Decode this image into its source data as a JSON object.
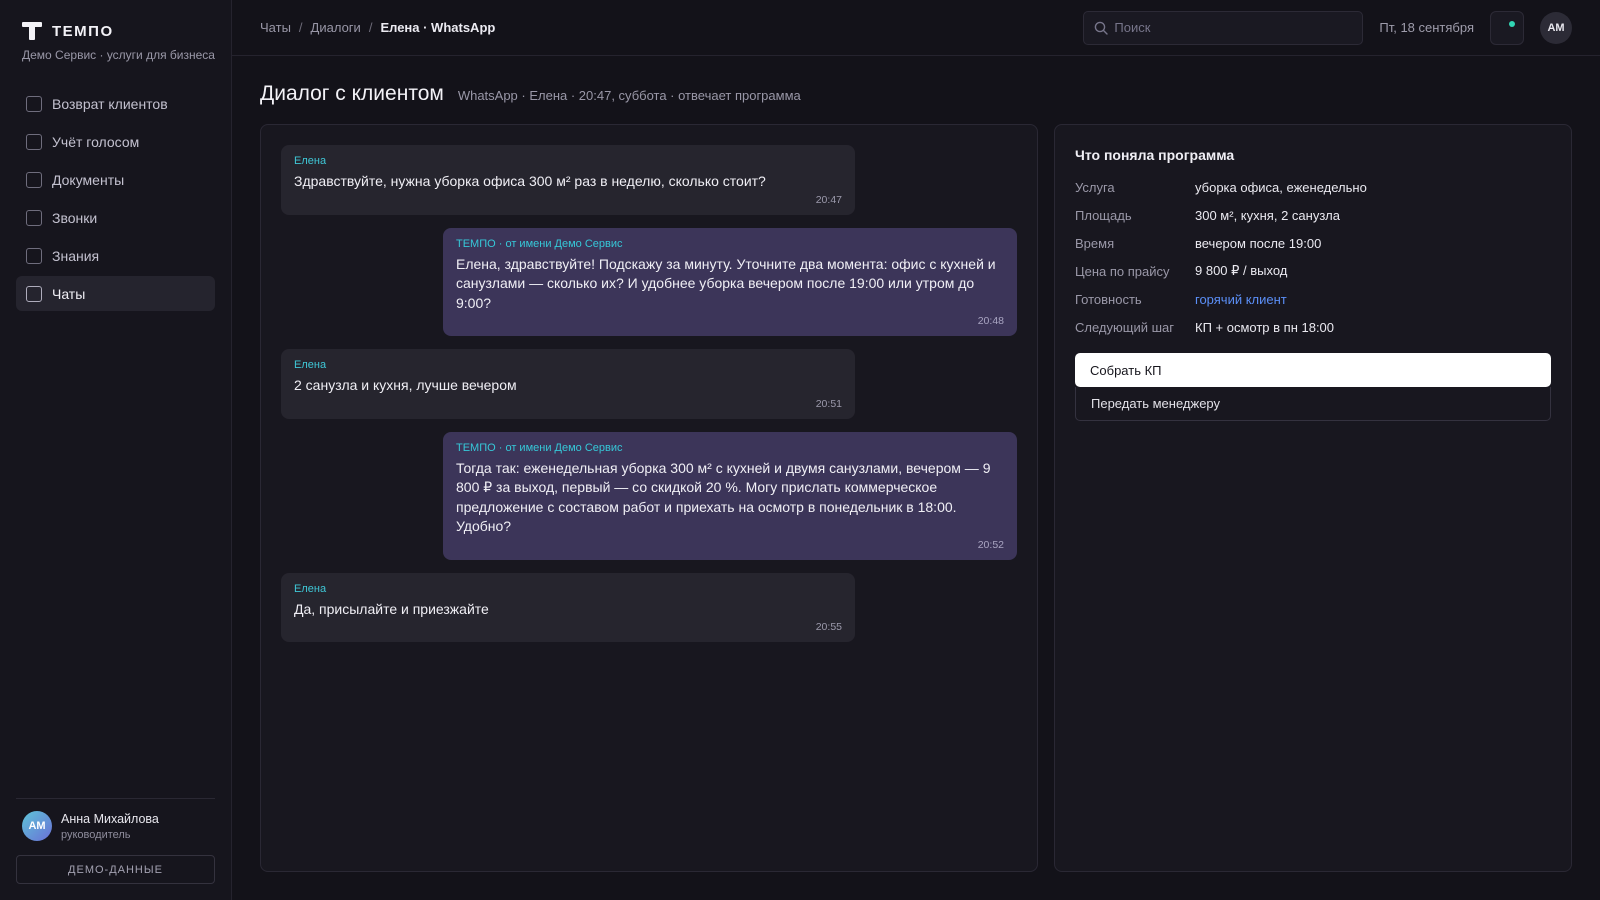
{
  "brand": {
    "name": "ТЕМПО",
    "subtitle": "Демо Сервис · услуги для бизнеса"
  },
  "sidebar": {
    "items": [
      {
        "label": "Возврат клиентов"
      },
      {
        "label": "Учёт голосом"
      },
      {
        "label": "Документы"
      },
      {
        "label": "Звонки"
      },
      {
        "label": "Знания"
      },
      {
        "label": "Чаты",
        "active": true
      }
    ],
    "user": {
      "initials": "АМ",
      "name": "Анна Михайлова",
      "role": "руководитель"
    },
    "demo_button": "ДЕМО-ДАННЫЕ"
  },
  "header": {
    "breadcrumbs": [
      "Чаты",
      "Диалоги",
      "Елена · WhatsApp"
    ],
    "search_placeholder": "Поиск",
    "date": "Пт, 18 сентября",
    "avatar_initials": "АМ"
  },
  "page": {
    "title": "Диалог с клиентом",
    "meta": "WhatsApp · Елена · 20:47, суббота · отвечает программа"
  },
  "messages": [
    {
      "direction": "in",
      "author": "Елена",
      "text": "Здравствуйте, нужна уборка офиса 300 м² раз в неделю, сколько стоит?",
      "time": "20:47"
    },
    {
      "direction": "out",
      "author": "ТЕМПО · от имени Демо Сервис",
      "text": "Елена, здравствуйте! Подскажу за минуту. Уточните два момента: офис с кухней и санузлами — сколько их? И удобнее уборка вечером после 19:00 или утром до 9:00?",
      "time": "20:48"
    },
    {
      "direction": "in",
      "author": "Елена",
      "text": "2 санузла и кухня, лучше вечером",
      "time": "20:51"
    },
    {
      "direction": "out",
      "author": "ТЕМПО · от имени Демо Сервис",
      "text": "Тогда так: еженедельная уборка 300 м² с кухней и двумя санузлами, вечером — 9 800 ₽ за выход, первый — со скидкой 20 %. Могу прислать коммерческое предложение с составом работ и приехать на осмотр в понедельник в 18:00. Удобно?",
      "time": "20:52"
    },
    {
      "direction": "in",
      "author": "Елена",
      "text": "Да, присылайте и приезжайте",
      "time": "20:55"
    }
  ],
  "insights": {
    "title": "Что поняла программа",
    "rows": [
      {
        "key": "Услуга",
        "value": "уборка офиса, еженедельно"
      },
      {
        "key": "Площадь",
        "value": "300 м², кухня, 2 санузла"
      },
      {
        "key": "Время",
        "value": "вечером после 19:00"
      },
      {
        "key": "Цена по прайсу",
        "value": "9 800 ₽ / выход"
      },
      {
        "key": "Готовность",
        "value": "горячий клиент",
        "accent": true
      },
      {
        "key": "Следующий шаг",
        "value": "КП + осмотр в пн 18:00"
      }
    ],
    "primary_button": "Собрать КП",
    "secondary_button": "Передать менеджеру"
  },
  "colors": {
    "background": "#131219",
    "accent_teal": "#36c8d8",
    "accent_blue": "#5b8ff7",
    "outgoing_bubble": "#3c3559",
    "incoming_bubble": "#26252e"
  }
}
